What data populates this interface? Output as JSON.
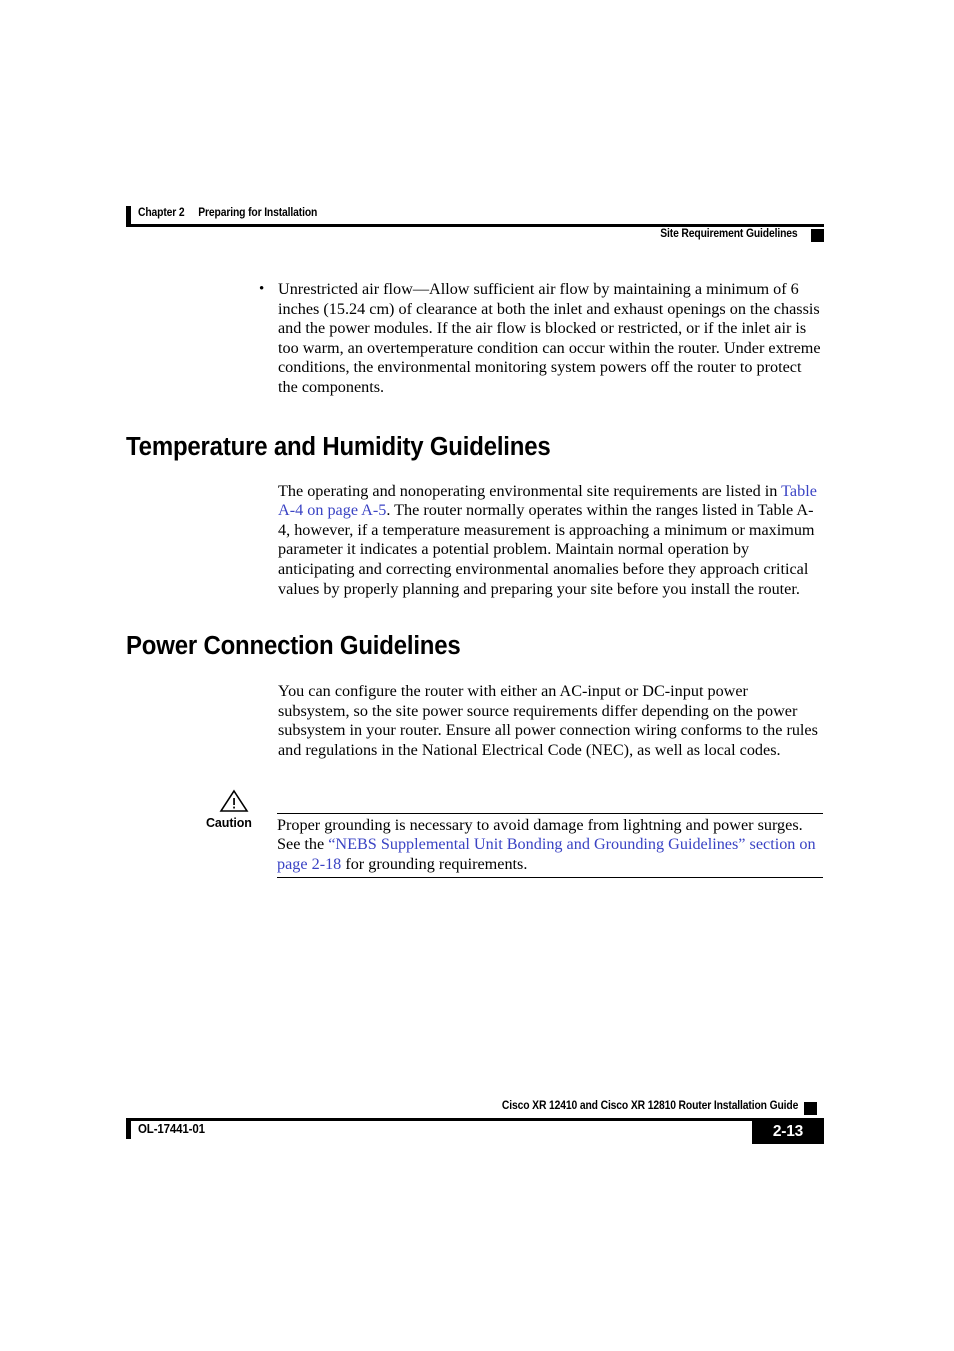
{
  "header": {
    "chapter_label": "Chapter 2",
    "chapter_title": "Preparing for Installation",
    "chapter_line": "Chapter 2     Preparing for Installation",
    "section_title": "Site Requirement Guidelines"
  },
  "body": {
    "bullet": {
      "marker": "•",
      "text": "Unrestricted air flow—Allow sufficient air flow by maintaining a minimum of 6 inches (15.24 cm) of clearance at both the inlet and exhaust openings on the chassis and the power modules. If the air flow is blocked or restricted, or if the inlet air is too warm, an overtemperature condition can occur within the router. Under extreme conditions, the environmental monitoring system powers off the router to protect the components."
    },
    "section_temperature": {
      "heading": "Temperature and Humidity Guidelines",
      "para_part1": "The operating and nonoperating environmental site requirements are listed in ",
      "link": "Table A-4 on page A-5",
      "para_part2": ". The router normally operates within the ranges listed in Table A-4, however, if a temperature measurement is approaching a minimum or maximum parameter it indicates a potential problem. Maintain normal operation by anticipating and correcting environmental anomalies before they approach critical values by properly planning and preparing your site before you install the router."
    },
    "section_power": {
      "heading": "Power Connection Guidelines",
      "para": "You can configure the router with either an AC-input or DC-input power subsystem, so the site power source requirements differ depending on the power subsystem in your router. Ensure all power connection wiring conforms to the rules and regulations in the National Electrical Code (NEC), as well as local codes."
    },
    "caution": {
      "label": "Caution",
      "icon": "warning-triangle-icon",
      "text_part1": "Proper grounding is necessary to avoid damage from lightning and power surges. See the ",
      "link": "“NEBS Supplemental Unit Bonding and Grounding Guidelines” section on page 2-18",
      "text_part2": " for grounding requirements."
    }
  },
  "footer": {
    "guide_title": "Cisco XR 12410 and Cisco XR 12810 Router Installation Guide",
    "doc_id": "OL-17441-01",
    "page_number": "2-13"
  },
  "colors": {
    "link": "#3a43c4",
    "text": "#000000",
    "background": "#ffffff"
  }
}
